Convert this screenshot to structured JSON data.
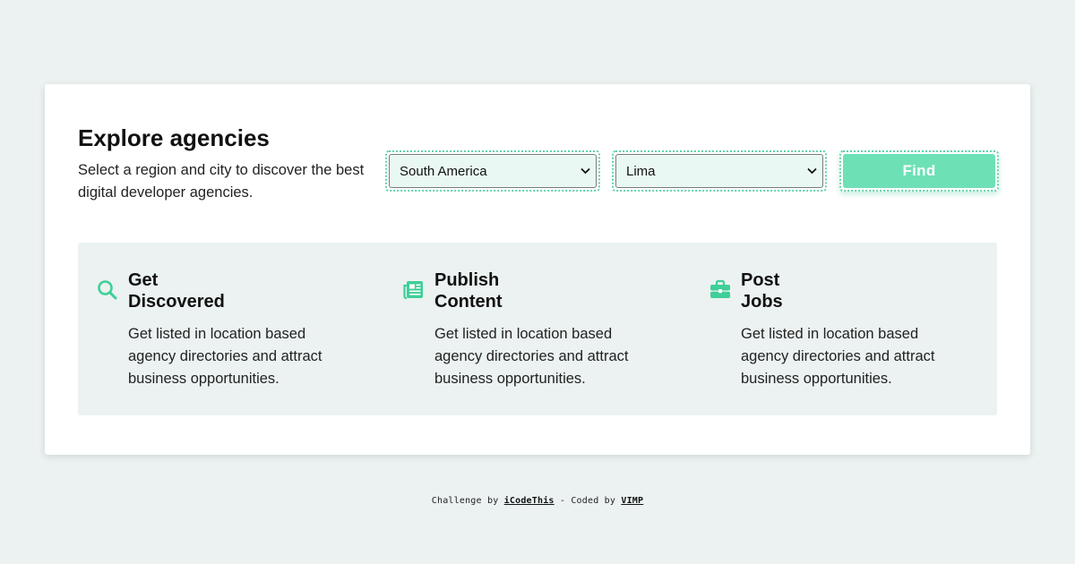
{
  "header": {
    "title": "Explore agencies",
    "subtitle": "Select a region and city to discover the best digital developer agencies."
  },
  "search": {
    "region_value": "South America",
    "city_value": "Lima",
    "find_label": "Find"
  },
  "features": [
    {
      "icon": "search-icon",
      "title_line1": "Get",
      "title_line2": "Discovered",
      "description": "Get listed in location based agency directories and attract business opportunities."
    },
    {
      "icon": "newspaper-icon",
      "title_line1": "Publish",
      "title_line2": "Content",
      "description": "Get listed in location based agency directories and attract business opportunities."
    },
    {
      "icon": "briefcase-icon",
      "title_line1": "Post",
      "title_line2": "Jobs",
      "description": "Get listed in location based agency directories and attract business opportunities."
    }
  ],
  "footer": {
    "prefix": "Challenge by",
    "link1": "iCodeThis",
    "middle": "- Coded by",
    "link2": "VIMP"
  },
  "colors": {
    "accent": "#5fd3a6",
    "button": "#6ee0b6",
    "background": "#ebf2f1"
  }
}
